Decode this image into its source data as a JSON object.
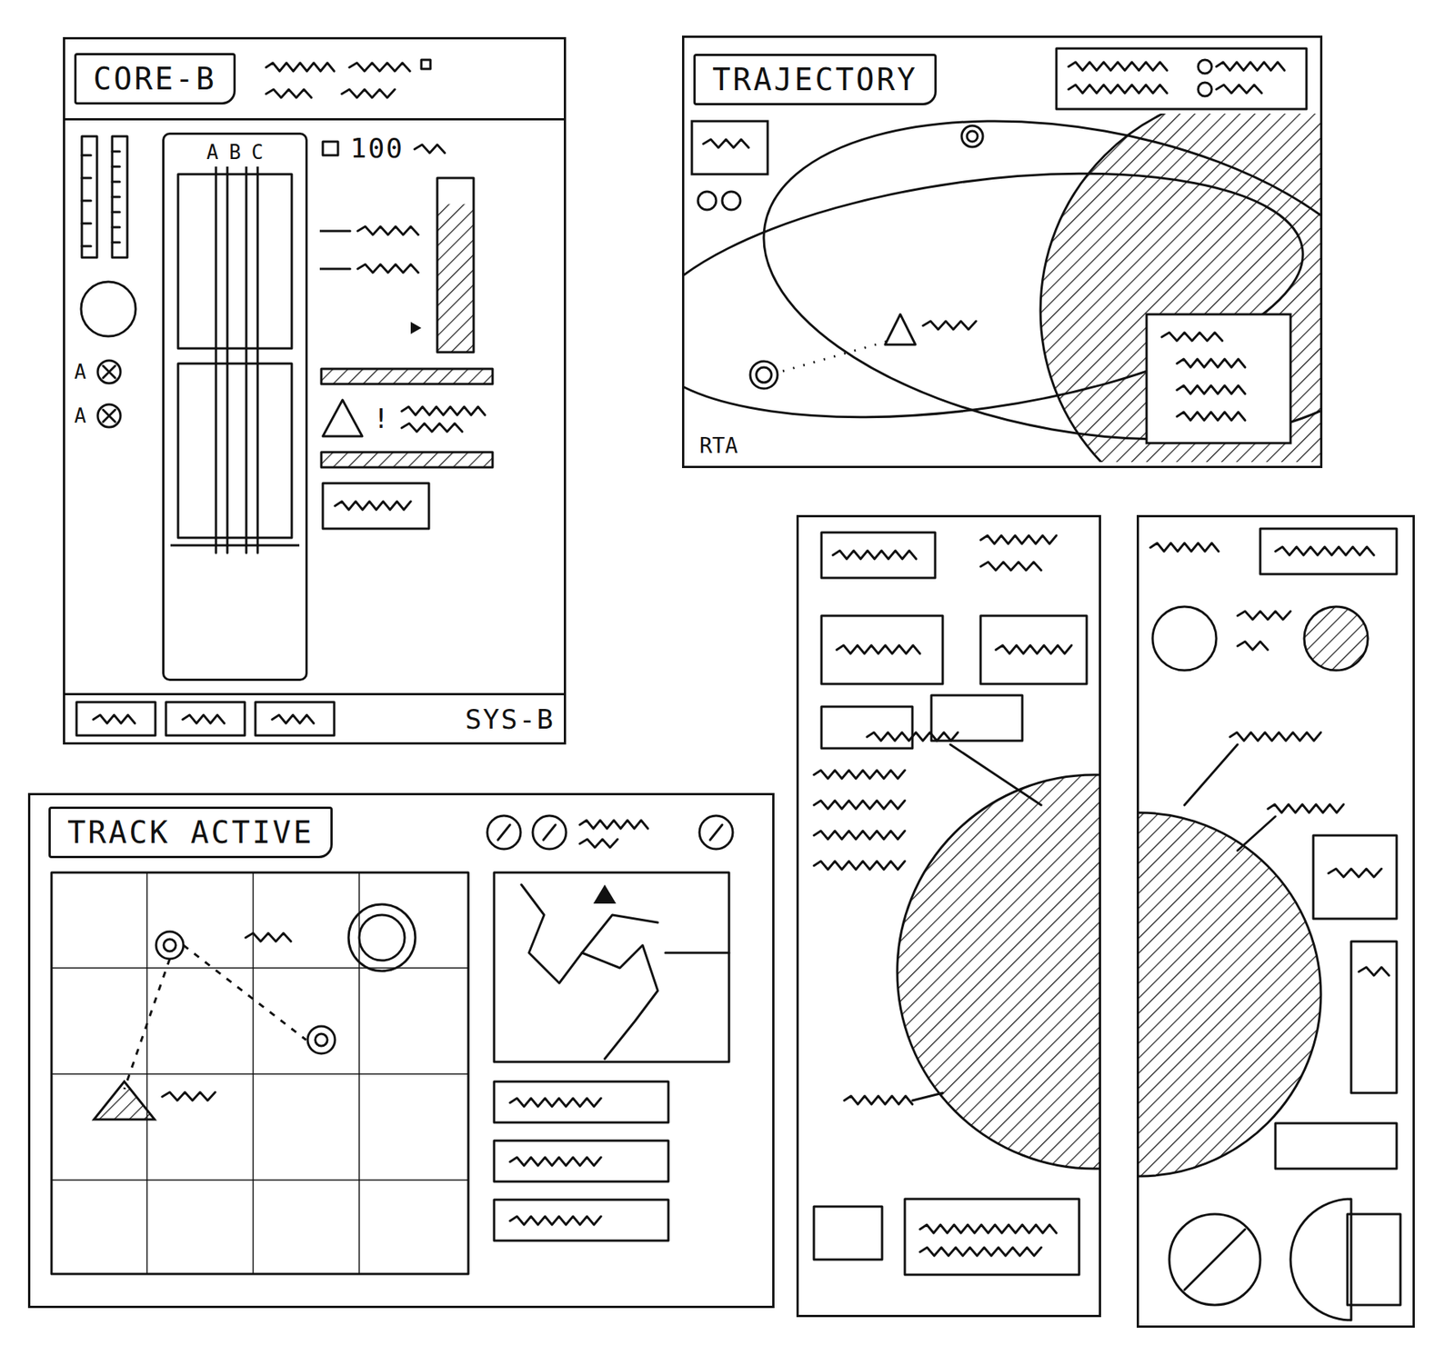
{
  "core": {
    "title": "CORE-B",
    "columns": [
      "A",
      "B",
      "C"
    ],
    "readout": "100",
    "switches": [
      {
        "label": "A",
        "crossed": true
      },
      {
        "label": "A",
        "crossed": true
      }
    ],
    "meter": {
      "level": 0.85
    },
    "progress": [
      {
        "level": 1
      },
      {
        "level": 1
      }
    ],
    "warning": "!",
    "footer": "SYS-B"
  },
  "trajectory": {
    "title": "TRAJECTORY",
    "marker": "RTA"
  },
  "track": {
    "title": "TRACK ACTIVE"
  }
}
